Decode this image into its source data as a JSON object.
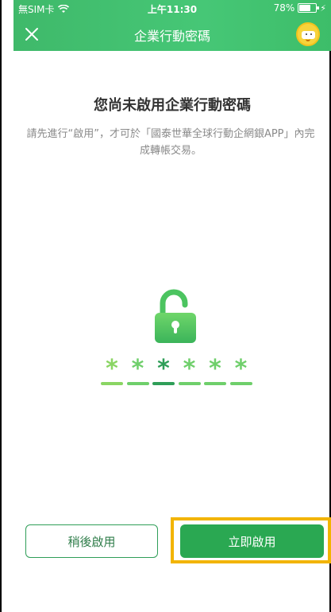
{
  "status_bar": {
    "carrier": "無SIM卡",
    "time": "上午11:30",
    "battery": "78%",
    "battery_level": 0.78
  },
  "nav": {
    "title": "企業行動密碼"
  },
  "content": {
    "heading": "您尚未啟用企業行動密碼",
    "description": "請先進行“啟用”，才可於「國泰世華全球行動企網銀APP」內完成轉帳交易。"
  },
  "password_mask": {
    "stars": [
      "*",
      "*",
      "*",
      "*",
      "*",
      "*"
    ],
    "active_index": 2,
    "colors": [
      "#8ad563",
      "#6fcf6b",
      "#2f9e58",
      "#6fcf6b",
      "#6fcf6b",
      "#6fcf6b"
    ]
  },
  "buttons": {
    "later_label": "稍後啟用",
    "now_label": "立即啟用"
  },
  "colors": {
    "brand_green": "#46c776",
    "button_green": "#2aa852",
    "highlight": "#f2b400"
  }
}
